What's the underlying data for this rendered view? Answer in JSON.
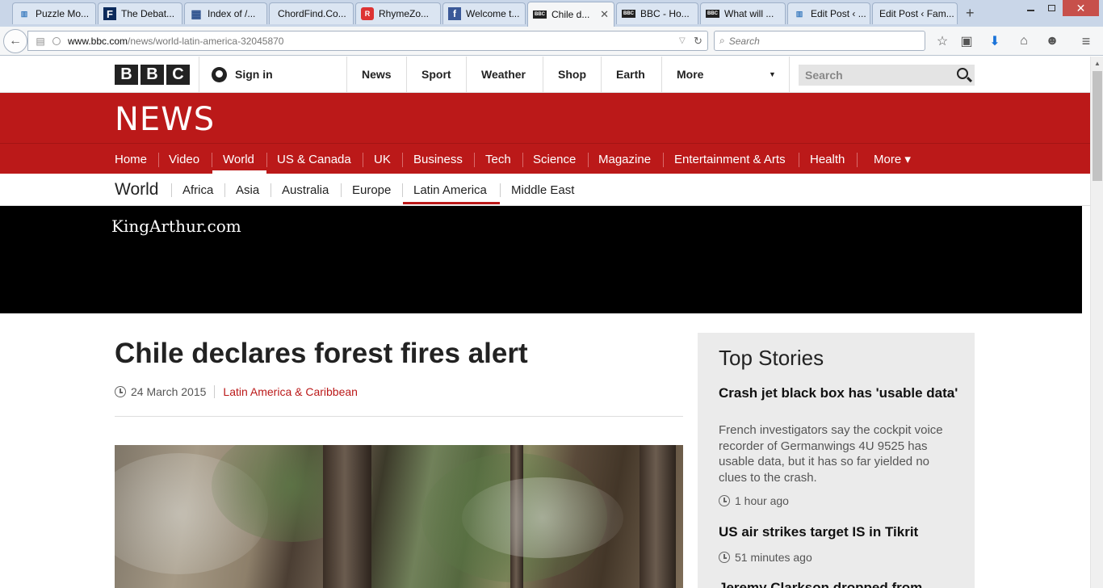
{
  "browser": {
    "tabs": [
      {
        "label": "Puzzle Mo...",
        "icon": "bar-chart-favicon"
      },
      {
        "label": "The Debat...",
        "icon": "letter-f-favicon"
      },
      {
        "label": "Index of /...",
        "icon": "grid-favicon"
      },
      {
        "label": "ChordFind.Co...",
        "icon": "blank-favicon"
      },
      {
        "label": "RhymeZo...",
        "icon": "rhymezone-favicon"
      },
      {
        "label": "Welcome t...",
        "icon": "facebook-favicon"
      },
      {
        "label": "Chile d...",
        "icon": "bbc-favicon"
      },
      {
        "label": "BBC - Ho...",
        "icon": "bbc-favicon"
      },
      {
        "label": "What will ...",
        "icon": "bbc-favicon"
      },
      {
        "label": "Edit Post ‹ ...",
        "icon": "bar-chart-favicon"
      },
      {
        "label": "Edit Post ‹ Fam...",
        "icon": "blank-favicon"
      }
    ],
    "tab_close": "✕",
    "new_tab": "+",
    "url_host": "www.bbc.com",
    "url_path": "/news/world-latin-america-32045870",
    "search_placeholder": "Search"
  },
  "masthead": {
    "logo": [
      "B",
      "B",
      "C"
    ],
    "sign_in": "Sign in",
    "nav": [
      "News",
      "Sport",
      "Weather",
      "Shop",
      "Earth",
      "More"
    ],
    "search_placeholder": "Search"
  },
  "news": {
    "wordmark": "NEWS",
    "nav": [
      "Home",
      "Video",
      "World",
      "US & Canada",
      "UK",
      "Business",
      "Tech",
      "Science",
      "Magazine",
      "Entertainment & Arts",
      "Health",
      "More ▾"
    ],
    "active_nav": "World"
  },
  "subnav": {
    "title": "World",
    "items": [
      "Africa",
      "Asia",
      "Australia",
      "Europe",
      "Latin America",
      "Middle East"
    ],
    "active": "Latin America"
  },
  "ad": {
    "text": "KingArthur.com"
  },
  "article": {
    "headline": "Chile declares forest fires alert",
    "date": "24 March 2015",
    "category": "Latin America & Caribbean"
  },
  "top_stories": {
    "title": "Top Stories",
    "stories": [
      {
        "title": "Crash jet black box has 'usable data'",
        "summary": "French investigators say the cockpit voice recorder of Germanwings 4U 9525 has usable data, but it has so far yielded no clues to the crash.",
        "time": "1 hour ago"
      },
      {
        "title": "US air strikes target IS in Tikrit",
        "time": "51 minutes ago"
      },
      {
        "title": "Jeremy Clarkson dropped from"
      }
    ]
  },
  "colors": {
    "bbc_red": "#bb1919",
    "ad_black": "#000000",
    "panel_gray": "#ebebeb"
  }
}
